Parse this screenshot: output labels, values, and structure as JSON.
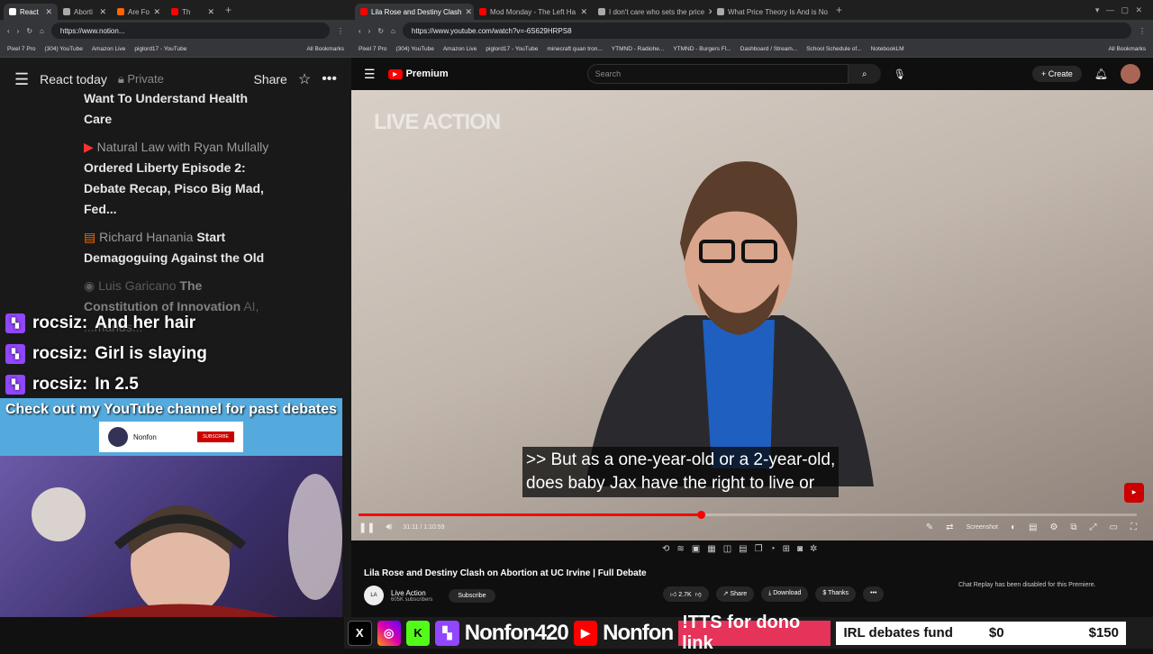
{
  "left_browser": {
    "tabs": [
      "React",
      "Aborti",
      "Are Fo",
      "Th"
    ],
    "url": "https://www.notion...",
    "bookmarks": [
      "Pixel 7 Pro",
      "(304) YouTube",
      "Amazon Live",
      "piglord17 - YouTube",
      "All Bookmarks"
    ]
  },
  "notion": {
    "page_title": "React today",
    "privacy": "Private",
    "share": "Share",
    "items": [
      {
        "source": "",
        "title": "Want To Understand Health Care"
      },
      {
        "source": "Natural Law with Ryan Mullally",
        "title": "Ordered Liberty Episode 2:  Debate Recap, Pisco Big Mad, Fed..."
      },
      {
        "source": "Richard Hanania",
        "title": "Start Demagoguing Against the Old"
      },
      {
        "source": "Luis Garicano",
        "title": "The Constitution of Innovation"
      }
    ],
    "faded": "AI, ...mands..."
  },
  "chat": [
    {
      "user": "rocsiz",
      "msg": "And her hair"
    },
    {
      "user": "rocsiz",
      "msg": "Girl is slaying"
    },
    {
      "user": "rocsiz",
      "msg": "In 2.5"
    }
  ],
  "overlay": {
    "cta": "Check out my YouTube channel for past debates",
    "channel": "Nonfon",
    "subscribe": "SUBSCRIBE"
  },
  "right_browser": {
    "tabs": [
      "Lila Rose and Destiny Clash",
      "Mod Monday - The Left Ha",
      "I don't care who sets the price",
      "What Price Theory Is And is No"
    ],
    "url": "https://www.youtube.com/watch?v=-6S629HRPS8",
    "bookmarks": [
      "Pixel 7 Pro",
      "(304) YouTube",
      "Amazon Live",
      "piglord17 - YouTube",
      "minecraft quan tron...",
      "YTMND - Radiohe...",
      "YTMND - Burgers Fl...",
      "Dashboard / Stream...",
      "School Schedule of...",
      "NotebookLM",
      "All Bookmarks"
    ]
  },
  "youtube": {
    "logo": "Premium",
    "search_placeholder": "Search",
    "create": "+ Create",
    "watermark": "LIVE ACTION",
    "caption_line1": ">> But as a one-year-old or a 2-year-old,",
    "caption_line2": "does baby Jax have the right to live or",
    "time": "31:11 / 1:10:59",
    "progress": 0.44,
    "screenshot": "Screenshot",
    "title": "Lila Rose and Destiny Clash on Abortion at UC Irvine | Full Debate",
    "channel": "Live Action",
    "subscribers": "605K subscribers",
    "subscribe": "Subscribe",
    "likes": "2.7K",
    "share": "Share",
    "download": "Download",
    "thanks": "Thanks",
    "replay_note": "Chat Replay has been disabled for this Premiere."
  },
  "bottom": {
    "handle1": "Nonfon420",
    "handle2": "Nonfon",
    "tts": "!TTS for dono link",
    "fund_label": "IRL debates fund",
    "fund_current": "$0",
    "fund_goal": "$150"
  }
}
